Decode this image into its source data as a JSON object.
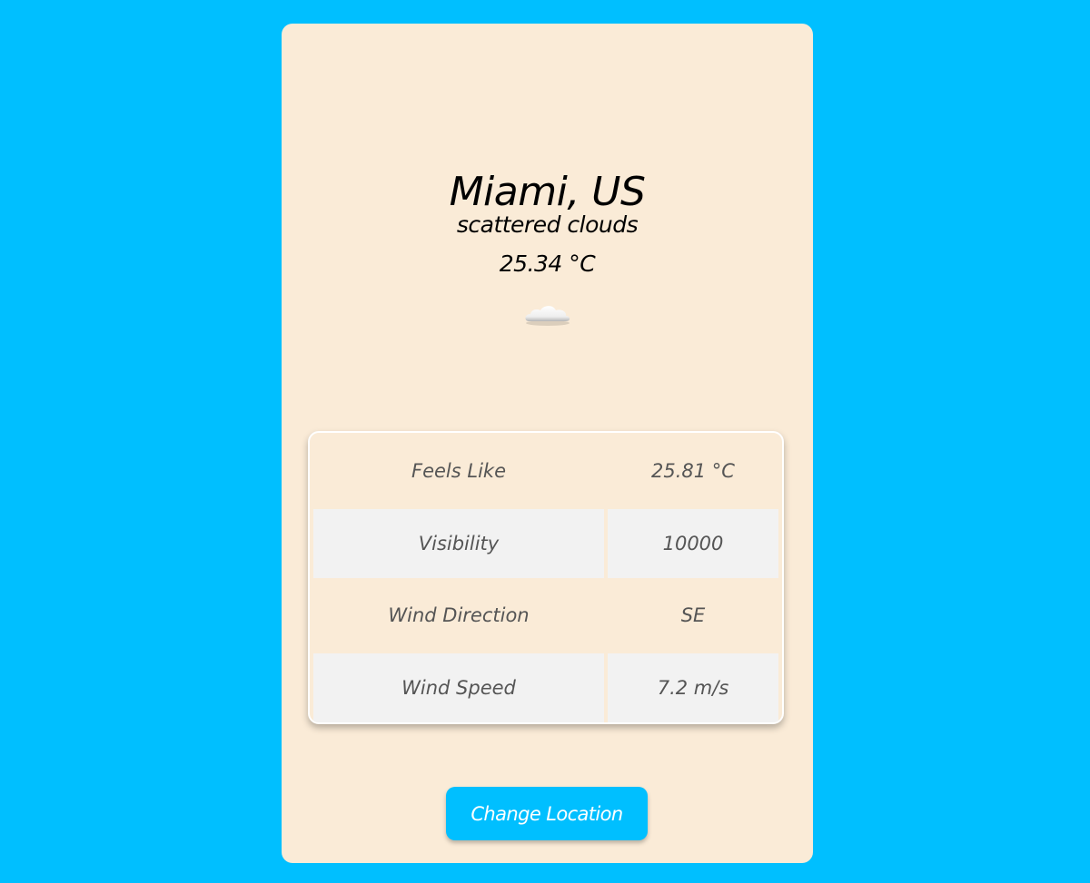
{
  "location": {
    "city": "Miami, US",
    "description": "scattered clouds",
    "temperature": "25.34 °C",
    "icon": "cloud-icon"
  },
  "details": [
    {
      "label": "Feels Like",
      "value": "25.81 °C"
    },
    {
      "label": "Visibility",
      "value": "10000"
    },
    {
      "label": "Wind Direction",
      "value": "SE"
    },
    {
      "label": "Wind Speed",
      "value": "7.2 m/s"
    }
  ],
  "actions": {
    "change_location_label": "Change Location"
  },
  "colors": {
    "background": "#00bfff",
    "card": "#faebd7",
    "row_alt": "#f2f2f2",
    "button": "#00bfff"
  }
}
